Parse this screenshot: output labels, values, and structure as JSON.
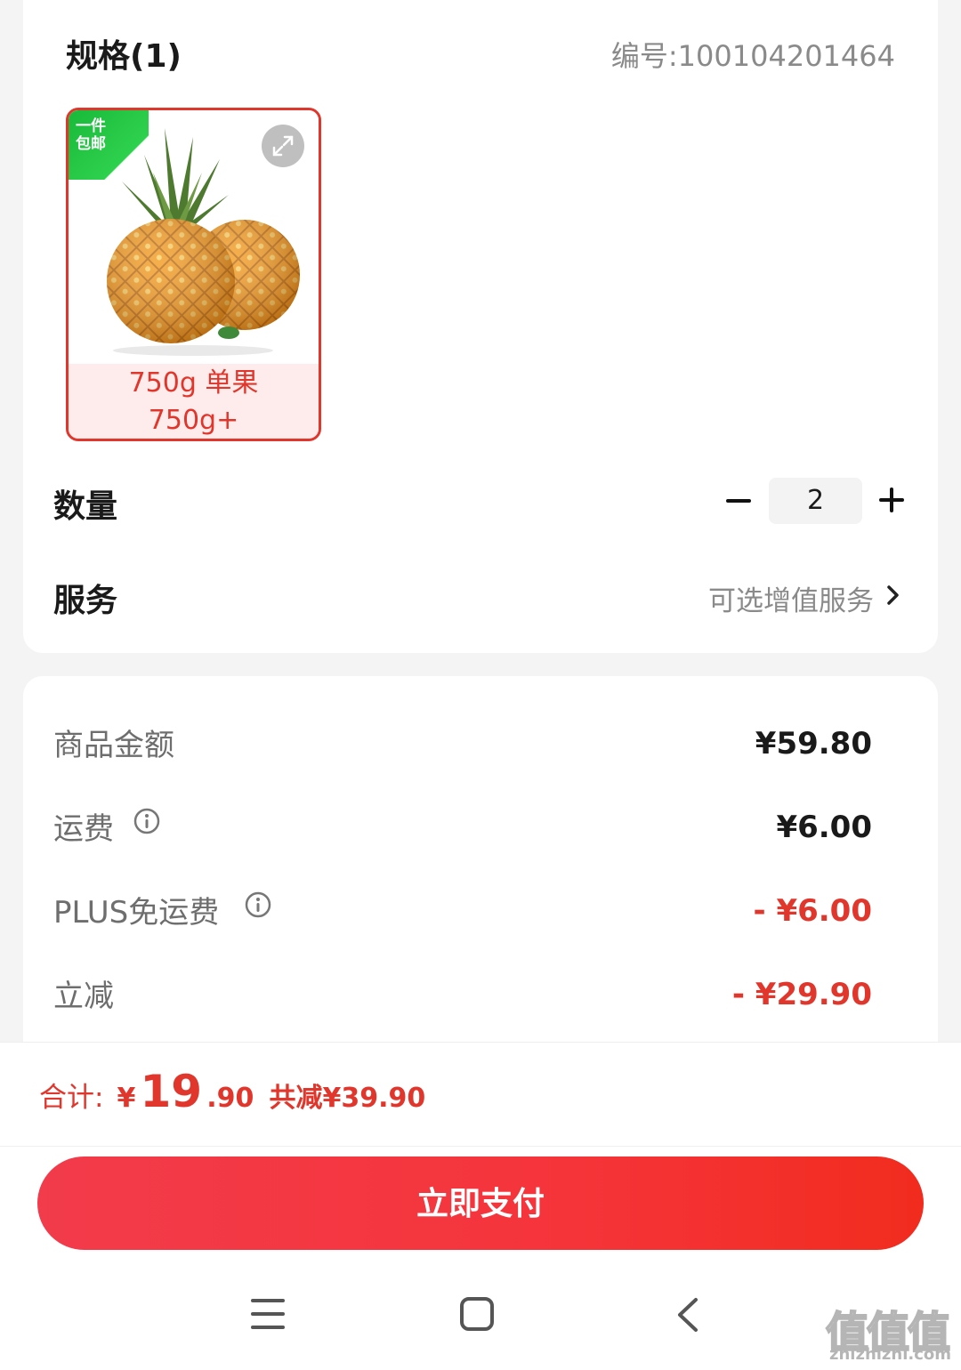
{
  "spec": {
    "title": "规格(1)",
    "code": "编号:100104201464",
    "item": {
      "badge": [
        "一件",
        "包邮"
      ],
      "label_line1": "750g 单果",
      "label_line2": "750g+"
    }
  },
  "quantity": {
    "label": "数量",
    "value": "2"
  },
  "service": {
    "label": "服务",
    "hint": "可选增值服务"
  },
  "prices": {
    "goods_label": "商品金额",
    "goods_value": "¥59.80",
    "shipping_label": "运费",
    "shipping_value": "¥6.00",
    "plus_label": "PLUS免运费",
    "plus_value": "- ¥6.00",
    "discount_label": "立减",
    "discount_value": "- ¥29.90"
  },
  "total": {
    "label": "合计:",
    "yen": "¥",
    "integer": "19",
    "decimal": ".90",
    "saved": "共减¥39.90"
  },
  "pay_button": "立即支付",
  "watermark": {
    "glyphs": "值值值",
    "url": "zhizhizhi.com"
  },
  "colors": {
    "accent": "#e0362c",
    "badge_green": "#19b93a",
    "pay_gradient_start": "#f23b4b",
    "pay_gradient_end": "#f12c1e"
  },
  "icons": [
    "expand-icon",
    "info-icon",
    "chevron-right-icon",
    "menu-icon",
    "home-icon",
    "back-icon"
  ]
}
